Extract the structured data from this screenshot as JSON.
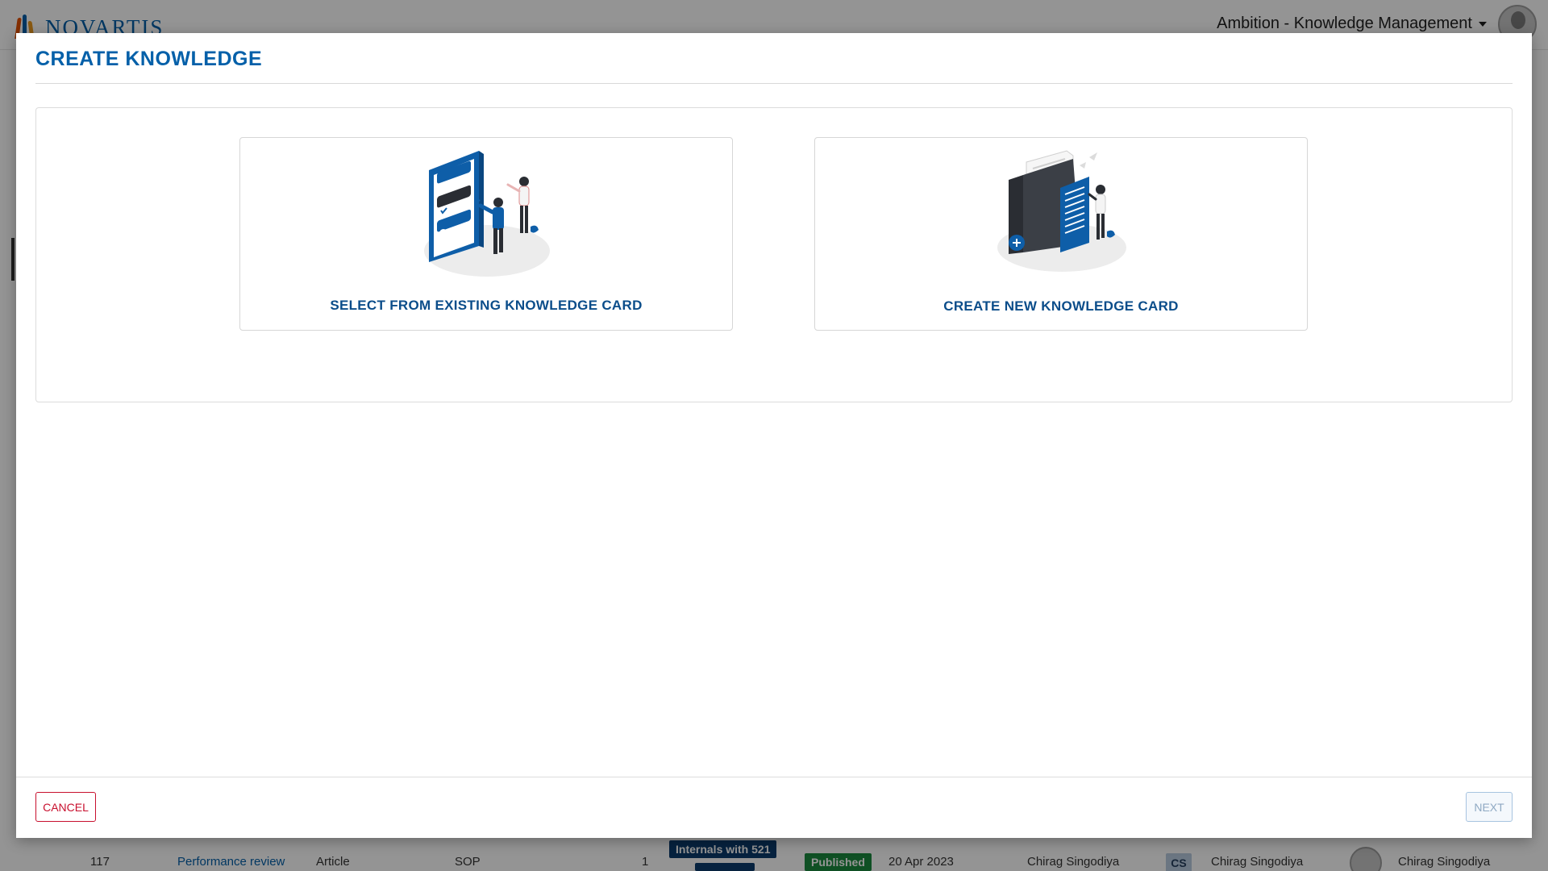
{
  "header": {
    "brand": "NOVARTIS",
    "app_switcher_label": "Ambition - Knowledge Management"
  },
  "background_row": {
    "id": "117",
    "title": "Performance review",
    "type": "Article",
    "category": "SOP",
    "count": "1",
    "audience_tag": "Internals with 521",
    "status": "Published",
    "date": "20 Apr 2023",
    "author": "Chirag Singodiya",
    "owner_initials": "CS",
    "owner": "Chirag Singodiya",
    "reviewer": "Chirag Singodiya"
  },
  "modal": {
    "title": "CREATE KNOWLEDGE",
    "options": [
      {
        "label": "SELECT FROM EXISTING KNOWLEDGE CARD",
        "icon": "select-existing-illustration"
      },
      {
        "label": "CREATE NEW KNOWLEDGE CARD",
        "icon": "create-new-illustration"
      }
    ],
    "cancel_label": "CANCEL",
    "next_label": "NEXT"
  },
  "colors": {
    "primary": "#0460a9",
    "cancel": "#c8102e",
    "published": "#1b8a3f",
    "tag_dark": "#0b3c6d"
  }
}
